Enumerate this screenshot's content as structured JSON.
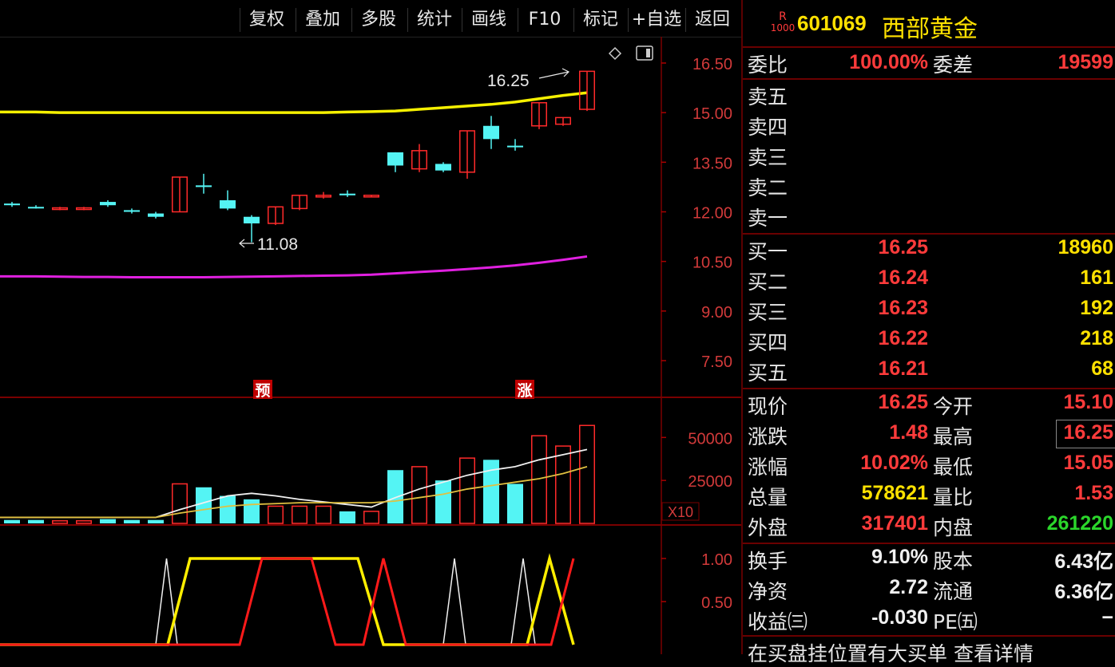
{
  "toolbar": {
    "items": [
      "复权",
      "叠加",
      "多股",
      "统计",
      "画线",
      "F10",
      "标记",
      "+自选",
      "返回"
    ]
  },
  "stock": {
    "badge_top": "R",
    "badge_bottom": "1000",
    "code": "601069",
    "name": "西部黄金"
  },
  "order_ratio": {
    "label": "委比",
    "value": "100.00%",
    "diff_label": "委差",
    "diff_value": "19599"
  },
  "sell": [
    {
      "label": "卖五",
      "price": "",
      "vol": ""
    },
    {
      "label": "卖四",
      "price": "",
      "vol": ""
    },
    {
      "label": "卖三",
      "price": "",
      "vol": ""
    },
    {
      "label": "卖二",
      "price": "",
      "vol": ""
    },
    {
      "label": "卖一",
      "price": "",
      "vol": ""
    }
  ],
  "buy": [
    {
      "label": "买一",
      "price": "16.25",
      "vol": "18960"
    },
    {
      "label": "买二",
      "price": "16.24",
      "vol": "161"
    },
    {
      "label": "买三",
      "price": "16.23",
      "vol": "192"
    },
    {
      "label": "买四",
      "price": "16.22",
      "vol": "218"
    },
    {
      "label": "买五",
      "price": "16.21",
      "vol": "68"
    }
  ],
  "stats": [
    {
      "l1": "现价",
      "v1": "16.25",
      "c1": "red",
      "l2": "今开",
      "v2": "15.10",
      "c2": "red"
    },
    {
      "l1": "涨跌",
      "v1": "1.48",
      "c1": "red",
      "l2": "最高",
      "v2": "16.25",
      "c2": "red"
    },
    {
      "l1": "涨幅",
      "v1": "10.02%",
      "c1": "red",
      "l2": "最低",
      "v2": "15.05",
      "c2": "red"
    },
    {
      "l1": "总量",
      "v1": "578621",
      "c1": "yel",
      "l2": "量比",
      "v2": "1.53",
      "c2": "red"
    },
    {
      "l1": "外盘",
      "v1": "317401",
      "c1": "red",
      "l2": "内盘",
      "v2": "261220",
      "c2": "grn"
    }
  ],
  "stats2": [
    {
      "l1": "换手",
      "v1": "9.10%",
      "l2": "股本",
      "v2": "6.43亿"
    },
    {
      "l1": "净资",
      "v1": "2.72",
      "l2": "流通",
      "v2": "6.36亿"
    },
    {
      "l1": "收益㈢",
      "v1": "-0.030",
      "l2": "PE㈤",
      "v2": "−"
    }
  ],
  "bottom_text": "在买盘挂位置有大买单 查看详情",
  "chart_data": {
    "type": "candlestick",
    "price_axis": {
      "ticks": [
        "16.50",
        "15.00",
        "13.50",
        "12.00",
        "10.50",
        "9.00",
        "7.50"
      ],
      "min": 7.5,
      "max": 16.5
    },
    "annotations": {
      "high_label": "16.25",
      "low_label": "11.08",
      "markers": [
        "预",
        "涨"
      ]
    },
    "candles": [
      {
        "o": 12.25,
        "c": 12.2,
        "h": 12.3,
        "l": 12.15,
        "up": false
      },
      {
        "o": 12.15,
        "c": 12.15,
        "h": 12.2,
        "l": 12.1,
        "up": false
      },
      {
        "o": 12.1,
        "c": 12.12,
        "h": 12.15,
        "l": 12.05,
        "up": true
      },
      {
        "o": 12.1,
        "c": 12.12,
        "h": 12.15,
        "l": 12.05,
        "up": true
      },
      {
        "o": 12.3,
        "c": 12.2,
        "h": 12.35,
        "l": 12.15,
        "up": false
      },
      {
        "o": 12.05,
        "c": 12.0,
        "h": 12.1,
        "l": 11.95,
        "up": false
      },
      {
        "o": 11.95,
        "c": 11.85,
        "h": 12.0,
        "l": 11.8,
        "up": false
      },
      {
        "o": 12.0,
        "c": 13.05,
        "h": 13.05,
        "l": 12.0,
        "up": true
      },
      {
        "o": 12.8,
        "c": 12.75,
        "h": 13.15,
        "l": 12.55,
        "up": false
      },
      {
        "o": 12.35,
        "c": 12.1,
        "h": 12.65,
        "l": 12.05,
        "up": false
      },
      {
        "o": 11.85,
        "c": 11.65,
        "h": 11.9,
        "l": 11.08,
        "up": false
      },
      {
        "o": 11.65,
        "c": 12.15,
        "h": 12.15,
        "l": 11.6,
        "up": true
      },
      {
        "o": 12.1,
        "c": 12.5,
        "h": 12.5,
        "l": 12.05,
        "up": true
      },
      {
        "o": 12.45,
        "c": 12.5,
        "h": 12.6,
        "l": 12.4,
        "up": true
      },
      {
        "o": 12.55,
        "c": 12.5,
        "h": 12.65,
        "l": 12.45,
        "up": false
      },
      {
        "o": 12.45,
        "c": 12.5,
        "h": 12.5,
        "l": 12.45,
        "up": true
      },
      {
        "o": 13.8,
        "c": 13.4,
        "h": 13.8,
        "l": 13.2,
        "up": false
      },
      {
        "o": 13.3,
        "c": 13.85,
        "h": 14.05,
        "l": 13.2,
        "up": true
      },
      {
        "o": 13.45,
        "c": 13.25,
        "h": 13.5,
        "l": 13.2,
        "up": false
      },
      {
        "o": 13.2,
        "c": 14.45,
        "h": 14.45,
        "l": 13.0,
        "up": true
      },
      {
        "o": 14.6,
        "c": 14.2,
        "h": 14.9,
        "l": 13.9,
        "up": false
      },
      {
        "o": 14.0,
        "c": 14.0,
        "h": 14.2,
        "l": 13.85,
        "up": false
      },
      {
        "o": 14.6,
        "c": 15.3,
        "h": 15.3,
        "l": 14.5,
        "up": true
      },
      {
        "o": 14.65,
        "c": 14.85,
        "h": 14.85,
        "l": 14.6,
        "up": true
      },
      {
        "o": 15.1,
        "c": 16.25,
        "h": 16.25,
        "l": 15.05,
        "up": true
      }
    ],
    "ma_yellow": [
      15.02,
      15.02,
      15.0,
      15.0,
      15.0,
      15.0,
      15.0,
      15.0,
      15.0,
      15.0,
      15.0,
      15.0,
      15.0,
      15.0,
      15.02,
      15.03,
      15.05,
      15.1,
      15.15,
      15.2,
      15.25,
      15.32,
      15.42,
      15.52,
      15.6
    ],
    "ma_magenta": [
      10.05,
      10.05,
      10.04,
      10.03,
      10.03,
      10.02,
      10.02,
      10.02,
      10.02,
      10.03,
      10.04,
      10.05,
      10.06,
      10.07,
      10.08,
      10.1,
      10.14,
      10.18,
      10.22,
      10.27,
      10.32,
      10.38,
      10.46,
      10.55,
      10.65
    ],
    "volume_axis": {
      "ticks": [
        "50000",
        "25000"
      ],
      "unit": "X10",
      "max": 65000
    },
    "volume": [
      2000,
      2000,
      1500,
      1500,
      2500,
      2000,
      2000,
      23000,
      21000,
      16000,
      14000,
      10000,
      10000,
      10000,
      7000,
      7000,
      31000,
      33000,
      25000,
      38000,
      37000,
      23000,
      51000,
      45000,
      57000
    ],
    "vol_ma_white": [
      3500,
      3500,
      3500,
      3500,
      3500,
      3500,
      3500,
      8000,
      12000,
      16000,
      17500,
      16000,
      14000,
      12500,
      11000,
      9500,
      15000,
      20000,
      24000,
      28000,
      31000,
      33000,
      37000,
      40000,
      43000
    ],
    "vol_ma_yellow": [
      3500,
      3500,
      3500,
      3500,
      3500,
      3500,
      3500,
      6000,
      8000,
      10000,
      11000,
      11500,
      12000,
      12000,
      12000,
      12000,
      13000,
      15000,
      17000,
      20000,
      22000,
      24000,
      26000,
      29000,
      33000
    ],
    "indicator_axis": {
      "ticks": [
        "1.00",
        "0.50"
      ]
    }
  }
}
